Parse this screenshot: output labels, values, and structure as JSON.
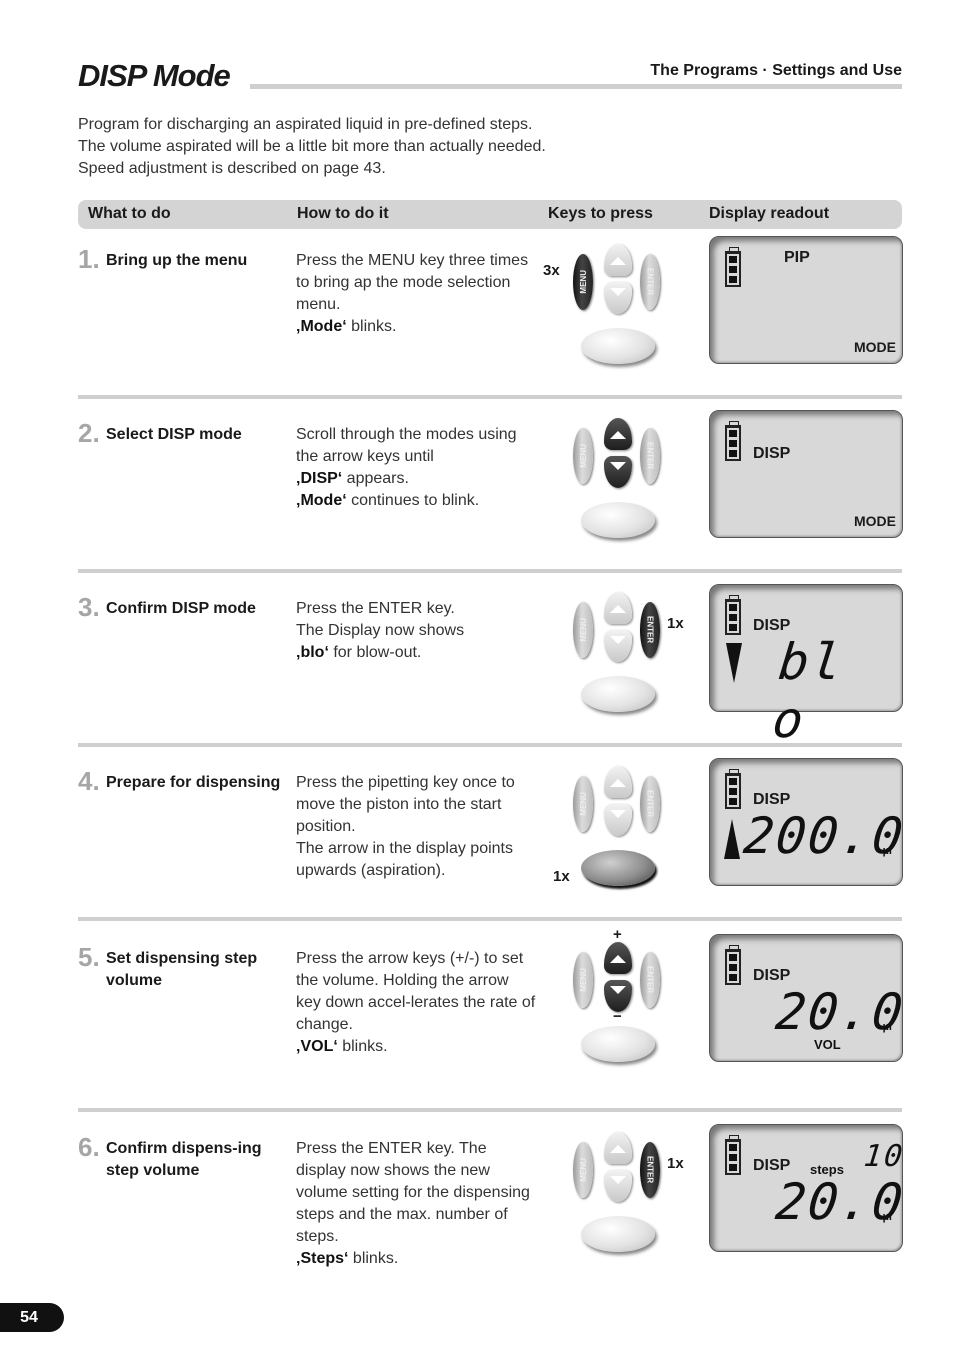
{
  "header": {
    "title": "DISP Mode",
    "section": "The Programs · Settings and Use"
  },
  "intro": [
    "Program for discharging an aspirated liquid in pre-defined steps.",
    "The volume aspirated will be a little bit more than actually needed.",
    "Speed adjustment is described on page 43."
  ],
  "table_header": {
    "what": "What to do",
    "how": "How to do it",
    "keys": "Keys to press",
    "display": "Display readout"
  },
  "keys": {
    "menu_label": "MENU",
    "enter_label": "ENTER"
  },
  "steps": [
    {
      "number": "1.",
      "title": "Bring up the menu",
      "desc": [
        {
          "text": "Press the MENU key three times to bring ap the mode selection menu."
        },
        {
          "bold": "‚Mode‘",
          "text": " blinks."
        }
      ],
      "press_count": "3x",
      "active_key": "menu",
      "lcd": {
        "mode_name": "PIP",
        "mode_label": "MODE"
      }
    },
    {
      "number": "2.",
      "title": "Select DISP mode",
      "desc": [
        {
          "text": "Scroll through the modes using the arrow keys until"
        },
        {
          "bold": "‚DISP‘",
          "text": " appears."
        },
        {
          "bold": "‚Mode‘",
          "text": " continues to blink."
        }
      ],
      "active_key": "arrows",
      "lcd": {
        "mode_name": "DISP",
        "mode_label": "MODE"
      }
    },
    {
      "number": "3.",
      "title": "Confirm DISP mode",
      "desc": [
        {
          "text": "Press the ENTER key."
        },
        {
          "text": "The Display now shows"
        },
        {
          "bold": "‚blo‘",
          "text": " for blow-out."
        }
      ],
      "press_count": "1x",
      "active_key": "enter",
      "lcd": {
        "mode_name": "DISP",
        "main": "bl o",
        "arrow": "down"
      }
    },
    {
      "number": "4.",
      "title": "Prepare for dispensing",
      "desc": [
        {
          "text": "Press the pipetting key once to move the piston into the start position."
        },
        {
          "text": "The arrow in the display points upwards (aspiration)."
        }
      ],
      "press_count": "1x",
      "active_key": "pipette",
      "lcd": {
        "mode_name": "DISP",
        "main": "200.0",
        "unit": "µl",
        "arrow": "up"
      }
    },
    {
      "number": "5.",
      "title": "Set dispensing step volume",
      "desc": [
        {
          "text": "Press the arrow keys (+/-) to set the volume. Holding the arrow key down accel-lerates the rate of change."
        },
        {
          "bold": "‚VOL‘",
          "text": " blinks."
        }
      ],
      "plus_label": "+",
      "minus_label": "−",
      "active_key": "arrows",
      "lcd": {
        "mode_name": "DISP",
        "main": "20.0",
        "unit": "µl",
        "sub_label": "VOL"
      }
    },
    {
      "number": "6.",
      "title": "Confirm dispens-ing step volume",
      "desc": [
        {
          "text": "Press the ENTER key. The display now shows the new volume setting for the dispensing steps and the max. number of steps."
        },
        {
          "bold": "‚Steps‘",
          "text": " blinks."
        }
      ],
      "press_count": "1x",
      "active_key": "enter",
      "lcd": {
        "mode_name": "DISP",
        "steps_label": "steps",
        "steps_value": "10",
        "main": "20.0",
        "unit": "µl"
      }
    }
  ],
  "page_number": "54"
}
